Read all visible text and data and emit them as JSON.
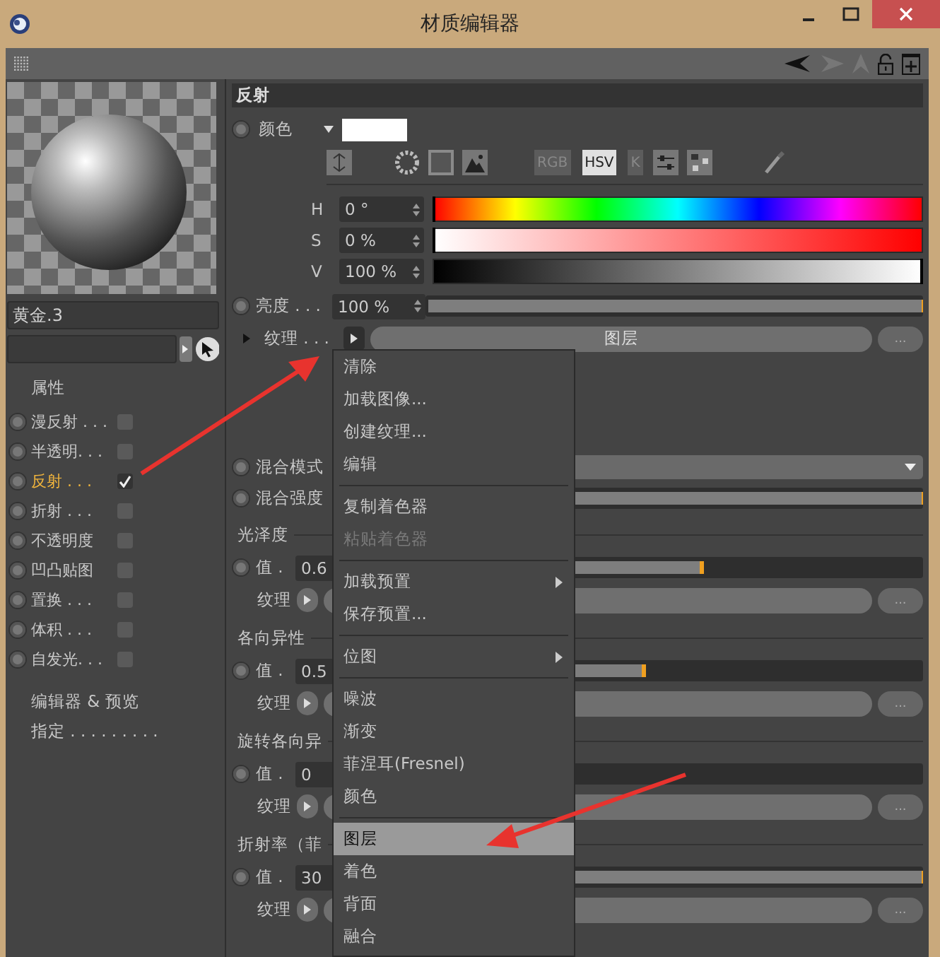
{
  "window": {
    "title": "材质编辑器"
  },
  "material": {
    "name": "黄金.3",
    "section_label": "属性",
    "channels": [
      {
        "label": "漫反射 . . .",
        "checked": false,
        "selected": false
      },
      {
        "label": "半透明. . .",
        "checked": false,
        "selected": false
      },
      {
        "label": "反射 . . .",
        "checked": true,
        "selected": true
      },
      {
        "label": "折射 . . .",
        "checked": false,
        "selected": false
      },
      {
        "label": "不透明度",
        "checked": false,
        "selected": false
      },
      {
        "label": "凹凸贴图",
        "checked": false,
        "selected": false
      },
      {
        "label": "置换 . . .",
        "checked": false,
        "selected": false
      },
      {
        "label": "体积 . . .",
        "checked": false,
        "selected": false
      },
      {
        "label": "自发光. . .",
        "checked": false,
        "selected": false
      }
    ],
    "links": [
      "编辑器 & 预览",
      "指定 . . . . . . . . ."
    ]
  },
  "reflection": {
    "title": "反射",
    "color": {
      "label": "颜色",
      "modes": [
        {
          "label": "RGB",
          "selected": false
        },
        {
          "label": "HSV",
          "selected": true
        },
        {
          "label": "K",
          "selected": false
        }
      ],
      "hsv": [
        {
          "label": "H",
          "value": "0 °",
          "level": 0,
          "kind": "hue"
        },
        {
          "label": "S",
          "value": "0 %",
          "level": 0,
          "kind": "saturation"
        },
        {
          "label": "V",
          "value": "100 %",
          "level": 1,
          "kind": "value"
        }
      ]
    },
    "brightness": {
      "label": "亮度 . . .",
      "value": "100 %",
      "level": 1
    },
    "texture": {
      "label": "纹理 . . .",
      "value": "图层",
      "more": "..."
    },
    "blend_mode": {
      "label": "混合模式"
    },
    "blend_strength": {
      "label": "混合强度",
      "level": 1
    },
    "groups": [
      {
        "title": "光泽度",
        "value_label": "值 .",
        "value": "0.6",
        "level": 0.58,
        "texture_label": "纹理",
        "more": "..."
      },
      {
        "title": "各向异性",
        "value_label": "值 .",
        "value": "0.5",
        "level": 0.47,
        "texture_label": "纹理",
        "more": "..."
      },
      {
        "title": "旋转各向异",
        "value_label": "值 .",
        "value": "0",
        "level": 0,
        "texture_label": "纹理",
        "more": "..."
      },
      {
        "title": "折射率（菲",
        "value_label": "值 .",
        "value": "30",
        "level": 1,
        "texture_label": "纹理",
        "more": "..."
      }
    ]
  },
  "context_menu": {
    "items": [
      {
        "kind": "item",
        "label": "清除",
        "disabled": false,
        "submenu": false,
        "selected": false
      },
      {
        "kind": "item",
        "label": "加载图像...",
        "disabled": false,
        "submenu": false,
        "selected": false
      },
      {
        "kind": "item",
        "label": "创建纹理...",
        "disabled": false,
        "submenu": false,
        "selected": false
      },
      {
        "kind": "item",
        "label": "编辑",
        "disabled": false,
        "submenu": false,
        "selected": false
      },
      {
        "kind": "separator"
      },
      {
        "kind": "item",
        "label": "复制着色器",
        "disabled": false,
        "submenu": false,
        "selected": false
      },
      {
        "kind": "item",
        "label": "粘贴着色器",
        "disabled": true,
        "submenu": false,
        "selected": false
      },
      {
        "kind": "separator"
      },
      {
        "kind": "item",
        "label": "加载预置",
        "disabled": false,
        "submenu": true,
        "selected": false
      },
      {
        "kind": "item",
        "label": "保存预置...",
        "disabled": false,
        "submenu": false,
        "selected": false
      },
      {
        "kind": "separator"
      },
      {
        "kind": "item",
        "label": "位图",
        "disabled": false,
        "submenu": true,
        "selected": false
      },
      {
        "kind": "separator"
      },
      {
        "kind": "item",
        "label": "噪波",
        "disabled": false,
        "submenu": false,
        "selected": false
      },
      {
        "kind": "item",
        "label": "渐变",
        "disabled": false,
        "submenu": false,
        "selected": false
      },
      {
        "kind": "item",
        "label": "菲涅耳(Fresnel)",
        "disabled": false,
        "submenu": false,
        "selected": false
      },
      {
        "kind": "item",
        "label": "颜色",
        "disabled": false,
        "submenu": false,
        "selected": false
      },
      {
        "kind": "separator"
      },
      {
        "kind": "item",
        "label": "图层",
        "disabled": false,
        "submenu": false,
        "selected": true
      },
      {
        "kind": "item",
        "label": "着色",
        "disabled": false,
        "submenu": false,
        "selected": false
      },
      {
        "kind": "item",
        "label": "背面",
        "disabled": false,
        "submenu": false,
        "selected": false
      },
      {
        "kind": "item",
        "label": "融合",
        "disabled": false,
        "submenu": false,
        "selected": false
      }
    ]
  }
}
